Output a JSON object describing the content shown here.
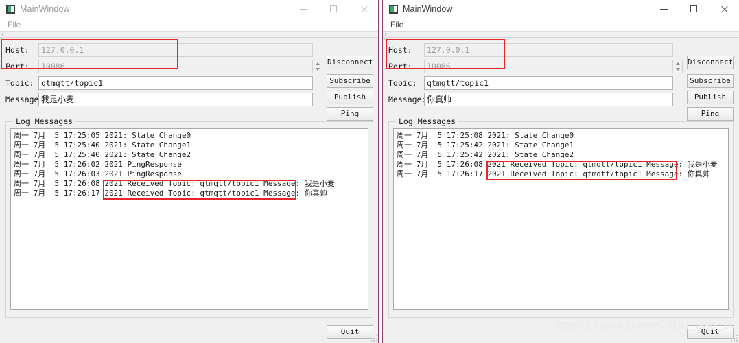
{
  "window_left": {
    "title": "MainWindow",
    "icon": "app-square-icon",
    "menu": {
      "file": "File"
    },
    "controls": {
      "minimize": "minimize-icon",
      "maximize": "maximize-icon",
      "close": "close-icon"
    },
    "form": {
      "host_label": "Host:",
      "host_value": "127.0.0.1",
      "port_label": "Port:",
      "port_value": "10086",
      "topic_label": "Topic:",
      "topic_value": "qtmqtt/topic1",
      "message_label": "Message:",
      "message_value": "我是小麦"
    },
    "buttons": {
      "disconnect": "Disconnect",
      "subscribe": "Subscribe",
      "publish": "Publish",
      "ping": "Ping",
      "quit": "Quit"
    },
    "log": {
      "group_title": "Log Messages",
      "lines": [
        "周一 7月  5 17:25:05 2021: State Change0",
        "周一 7月  5 17:25:40 2021: State Change1",
        "周一 7月  5 17:25:40 2021: State Change2",
        "周一 7月  5 17:26:02 2021 PingResponse",
        "周一 7月  5 17:26:03 2021 PingResponse",
        "周一 7月  5 17:26:08 2021 Received Topic: qtmqtt/topic1 Message: 我是小麦",
        "周一 7月  5 17:26:17 2021 Received Topic: qtmqtt/topic1 Message: 你真帅"
      ]
    }
  },
  "window_right": {
    "title": "MainWindow",
    "icon": "app-square-icon",
    "menu": {
      "file": "File"
    },
    "controls": {
      "minimize": "minimize-icon",
      "maximize": "maximize-icon",
      "close": "close-icon"
    },
    "form": {
      "host_label": "Host:",
      "host_value": "127.0.0.1",
      "port_label": "Port:",
      "port_value": "10086",
      "topic_label": "Topic:",
      "topic_value": "qtmqtt/topic1",
      "message_label": "Message:",
      "message_value": "你真帅"
    },
    "buttons": {
      "disconnect": "Disconnect",
      "subscribe": "Subscribe",
      "publish": "Publish",
      "ping": "Ping",
      "quit": "Quit"
    },
    "log": {
      "group_title": "Log Messages",
      "lines": [
        "周一 7月  5 17:25:08 2021: State Change0",
        "周一 7月  5 17:25:42 2021: State Change1",
        "周一 7月  5 17:25:42 2021: State Change2",
        "周一 7月  5 17:26:08 2021 Received Topic: qtmqtt/topic1 Message: 我是小麦",
        "周一 7月  5 17:26:17 2021 Received Topic: qtmqtt/topic1 Message: 你真帅"
      ]
    }
  },
  "annotations": {
    "highlight_color": "#e8262a",
    "watermark": "https://blog.csdn.net/CSDN_Gao_16"
  }
}
